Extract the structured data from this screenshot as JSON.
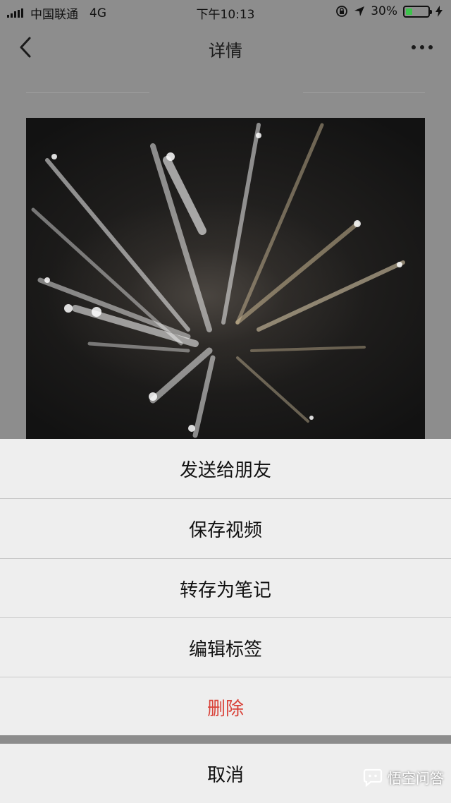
{
  "status_bar": {
    "carrier": "中国联通",
    "network": "4G",
    "time": "下午10:13",
    "battery": "30%",
    "battery_level": 0.3,
    "battery_color": "#3cc34b"
  },
  "nav": {
    "back_icon": "chevron-left-icon",
    "title": "详情",
    "more_icon": "ellipsis-icon"
  },
  "media": {
    "kind": "video",
    "description_icon": "fireworks-image"
  },
  "action_sheet": {
    "items": [
      {
        "label": "发送给朋友"
      },
      {
        "label": "保存视频"
      },
      {
        "label": "转存为笔记"
      },
      {
        "label": "编辑标签"
      },
      {
        "label": "删除"
      }
    ],
    "danger_color": "#d9433a",
    "cancel_label": "取消"
  },
  "watermark": {
    "text": "悟空问答"
  }
}
